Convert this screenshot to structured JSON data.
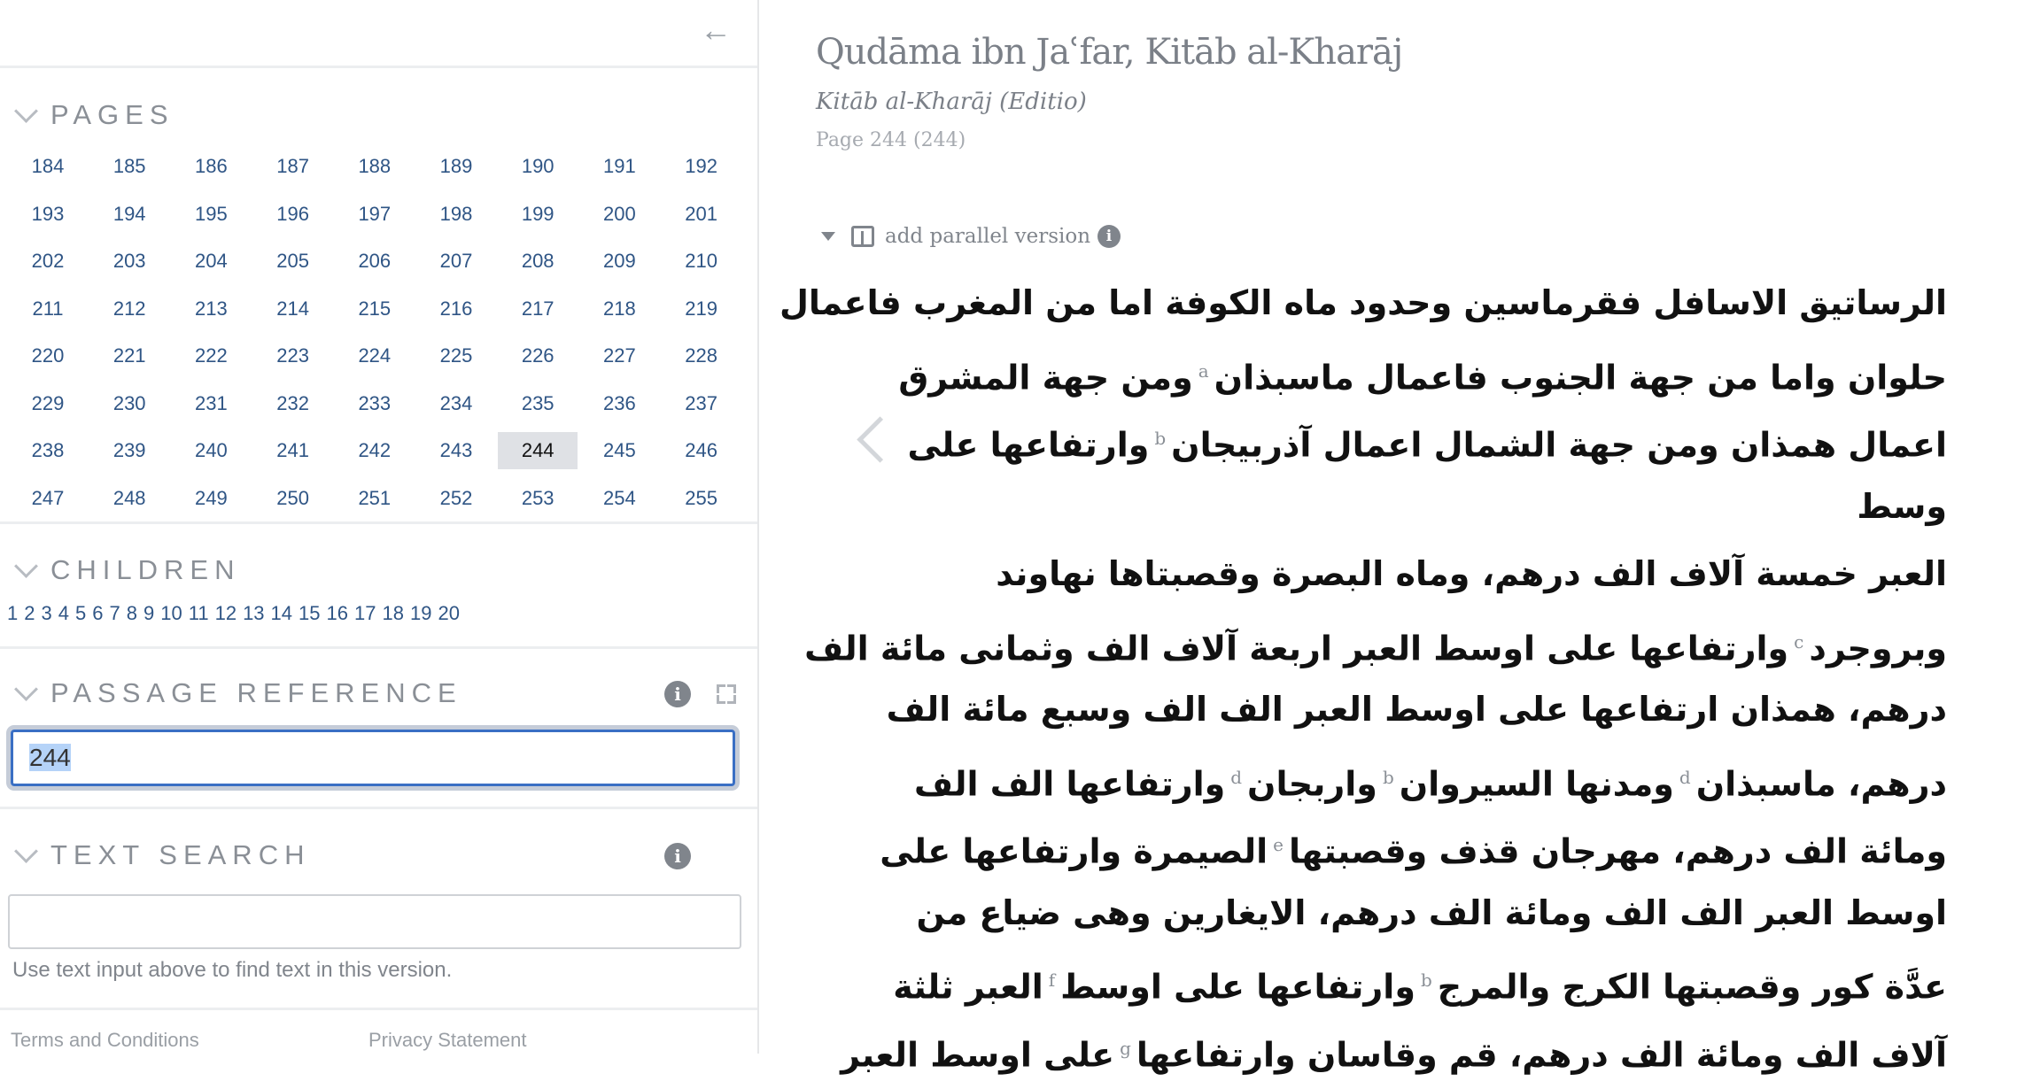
{
  "sidebar": {
    "back_icon": "arrow-left-icon",
    "pages": {
      "heading": "PAGES",
      "items": [
        "184",
        "185",
        "186",
        "187",
        "188",
        "189",
        "190",
        "191",
        "192",
        "193",
        "194",
        "195",
        "196",
        "197",
        "198",
        "199",
        "200",
        "201",
        "202",
        "203",
        "204",
        "205",
        "206",
        "207",
        "208",
        "209",
        "210",
        "211",
        "212",
        "213",
        "214",
        "215",
        "216",
        "217",
        "218",
        "219",
        "220",
        "221",
        "222",
        "223",
        "224",
        "225",
        "226",
        "227",
        "228",
        "229",
        "230",
        "231",
        "232",
        "233",
        "234",
        "235",
        "236",
        "237",
        "238",
        "239",
        "240",
        "241",
        "242",
        "243",
        "244",
        "245",
        "246",
        "247",
        "248",
        "249",
        "250",
        "251",
        "252",
        "253",
        "254",
        "255"
      ],
      "selected": "244"
    },
    "children": {
      "heading": "CHILDREN",
      "items": [
        "1",
        "2",
        "3",
        "4",
        "5",
        "6",
        "7",
        "8",
        "9",
        "10",
        "11",
        "12",
        "13",
        "14",
        "15",
        "16",
        "17",
        "18",
        "19",
        "20"
      ]
    },
    "passage_reference": {
      "heading": "PASSAGE REFERENCE",
      "value": "244"
    },
    "text_search": {
      "heading": "TEXT SEARCH",
      "value": "",
      "help": "Use text input above to find text in this version."
    },
    "footer": {
      "terms": "Terms and Conditions",
      "privacy": "Privacy Statement"
    }
  },
  "main": {
    "title": "Qudāma ibn Jaʿfar, Kitāb al-Kharāj",
    "subtitle_work": "Kitāb al-Kharāj",
    "subtitle_version": "(Editio)",
    "page_line": "Page 244 (244)",
    "add_parallel": "add parallel version",
    "lines": [
      [
        {
          "t": "الرساتيق الاسافل فقرماسين وحدود ماه الكوفة اما من المغرب فاعمال"
        }
      ],
      [
        {
          "t": "حلوان واما من جهة الجنوب فاعمال ماسبذان"
        },
        {
          "n": "a"
        },
        {
          "t": "ومن جهة المشرق"
        }
      ],
      [
        {
          "t": "اعمال همذان ومن جهة الشمال اعمال آذربيجان"
        },
        {
          "n": "b"
        },
        {
          "t": "وارتفاعها على"
        }
      ],
      [
        {
          "t": "وسط"
        }
      ],
      [
        {
          "t": "العبر خمسة آلاف الف درهم، وماه البصرة وقصبتاها نهاوند"
        }
      ],
      [
        {
          "t": "وبروجرد"
        },
        {
          "n": "c"
        },
        {
          "t": "وارتفاعها على اوسط العبر اربعة آلاف الف وثمانى مائة الف"
        }
      ],
      [
        {
          "t": "درهم، همذان ارتفاعها على اوسط العبر الف الف وسبع مائة الف"
        }
      ],
      [
        {
          "t": "درهم، ماسبذان"
        },
        {
          "n": "d"
        },
        {
          "t": "ومدنها السيروان"
        },
        {
          "n": "b"
        },
        {
          "t": "واربجان"
        },
        {
          "n": "d"
        },
        {
          "t": "وارتفاعها الف الف"
        }
      ],
      [
        {
          "t": "ومائة الف درهم، مهرجان قذف وقصبتها"
        },
        {
          "n": "e"
        },
        {
          "t": "الصيمرة وارتفاعها على"
        }
      ],
      [
        {
          "t": "اوسط العبر الف الف ومائة الف درهم، الايغارين وهى ضياع من"
        }
      ],
      [
        {
          "t": "عدَّة كور وقصبتها الكرج والمرج"
        },
        {
          "n": "b"
        },
        {
          "t": "وارتفاعها على اوسط"
        },
        {
          "n": "f"
        },
        {
          "t": "العبر ثلثة"
        }
      ],
      [
        {
          "t": "آلاف الف ومائة الف درهم، قم وقاسان وارتفاعها"
        },
        {
          "n": "g"
        },
        {
          "t": "على اوسط العبر"
        }
      ]
    ]
  },
  "colors": {
    "link": "#2f5585",
    "heading": "#8a8f96",
    "selected_page_bg": "#dfe1e5",
    "focus": "#3a6fc4"
  }
}
